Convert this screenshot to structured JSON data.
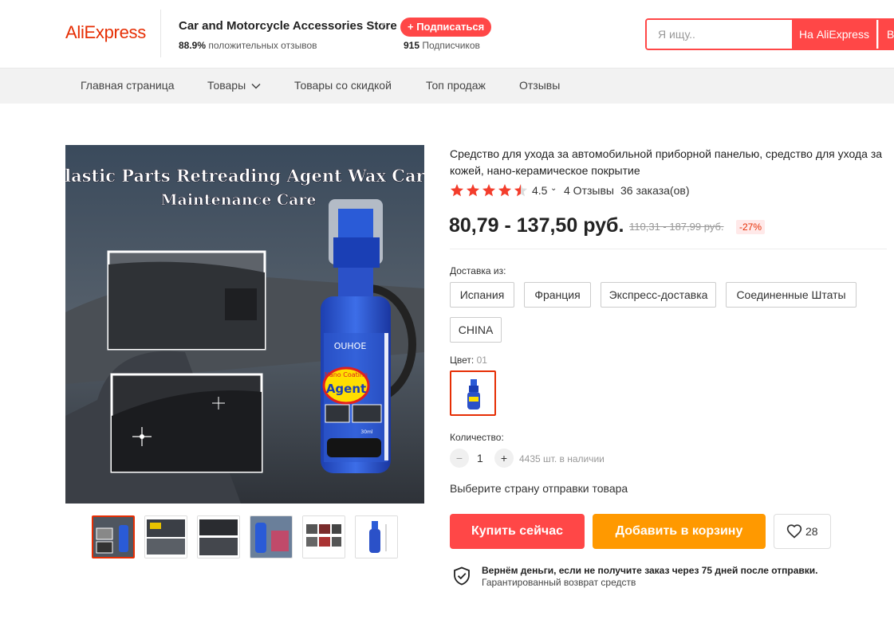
{
  "header": {
    "logo": "AliExpress",
    "store_name": "Car and Motorcycle Accessories Store",
    "positive_pct": "88.9%",
    "positive_label": "положительных отзывов",
    "subscribe_label": "+ Подписаться",
    "subscribers_count": "915",
    "subscribers_label": "Подписчиков",
    "search_placeholder": "Я ищу..",
    "search_button": "На AliExpress",
    "search_button_2": "В"
  },
  "nav": [
    "Главная страница",
    "Товары",
    "Товары со скидкой",
    "Топ продаж",
    "Отзывы"
  ],
  "gallery": {
    "image_title_line1": "Plastic Parts Retreading Agent Wax Car",
    "image_title_line2": "Maintenance Care",
    "brand": "OUHOE",
    "sticker_line1": "Nano Coating",
    "sticker_line2": "Agent",
    "volume": "30ml",
    "thumb_count": 6
  },
  "product": {
    "title": "Средство для ухода за автомобильной приборной панелью, средство для ухода за кожей, нано-керамическое покрытие",
    "rating": "4.5",
    "rating_fraction": 0.9,
    "reviews": "4 Отзывы",
    "orders": "36 заказа(ов)",
    "price": "80,79 - 137,50 руб.",
    "old_price": "110,31 - 187,99 руб.",
    "discount": "-27%",
    "shipping_label": "Доставка из:",
    "shipping_options": [
      "Испания",
      "Франция",
      "Экспресс-доставка",
      "Соединенные Штаты",
      "CHINA"
    ],
    "color_label": "Цвет:",
    "color_value": "01",
    "quantity_label": "Количество:",
    "quantity": "1",
    "qty_minus": "−",
    "qty_plus": "+",
    "stock": "4435 шт. в наличии",
    "choose_country": "Выберите страну отправки товара",
    "buy_now": "Купить сейчас",
    "add_to_cart": "Добавить в корзину",
    "wishlist_count": "28",
    "guarantee_title": "Вернём деньги, если не получите заказ через 75 дней после отправки.",
    "guarantee_subtitle": "Гарантированный возврат средств"
  },
  "colors": {
    "brand_red": "#e62e04",
    "button_red": "#ff4747",
    "button_orange": "#ff9900",
    "star": "#f33d2c"
  },
  "icons": [
    "chevron-down-icon",
    "star-icon",
    "heart-icon",
    "shield-check-icon",
    "minus-icon",
    "plus-icon"
  ]
}
